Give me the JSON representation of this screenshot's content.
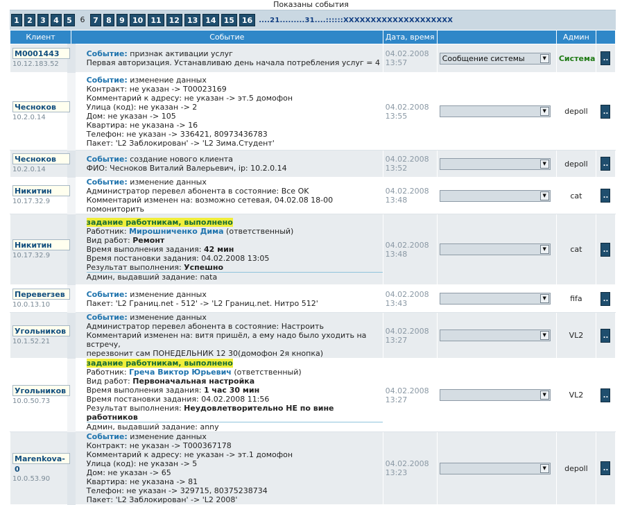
{
  "caption": "Показаны события",
  "pager": {
    "pages": [
      "1",
      "2",
      "3",
      "4",
      "5",
      "6",
      "7",
      "8",
      "9",
      "10",
      "11",
      "12",
      "13",
      "14",
      "15",
      "16"
    ],
    "current": "6",
    "tail": "....21.........31....::::::XXXXXXXXXXXXXXXXXXXX"
  },
  "columns": [
    "Клиент",
    "Событие",
    "Дата, время",
    "",
    "Админ",
    ""
  ],
  "rows": [
    {
      "client": "M0001443",
      "ip": "10.12.183.52",
      "event": [
        [
          "kw",
          "Событие:"
        ],
        [
          "t",
          " признак активации услуг"
        ],
        [
          "br"
        ],
        [
          "t",
          "Первая авторизация. Устанавливаю день начала потребления услуг = 4"
        ]
      ],
      "date": "04.02.2008",
      "time": "13:57",
      "select": "Сообщение системы",
      "admin": "Система",
      "admin_sys": true,
      "act": ".."
    },
    {
      "client": "Чесноков",
      "ip": "10.2.0.14",
      "event": [
        [
          "kw",
          "Событие:"
        ],
        [
          "t",
          " изменение данных"
        ],
        [
          "br"
        ],
        [
          "t",
          "Контракт: не указан -> T00023169"
        ],
        [
          "br"
        ],
        [
          "t",
          "Комментарий к адресу: не указан -> эт.5 домофон"
        ],
        [
          "br"
        ],
        [
          "t",
          "Улица (код): не указан -> 2"
        ],
        [
          "br"
        ],
        [
          "t",
          "Дом: не указан -> 105"
        ],
        [
          "br"
        ],
        [
          "t",
          "Квартира: не указана -> 16"
        ],
        [
          "br"
        ],
        [
          "t",
          "Телефон: не указан -> 336421, 80973436783"
        ],
        [
          "br"
        ],
        [
          "t",
          "Пакет: 'L2 Заблокирован' -> 'L2 Зима.Студент'"
        ]
      ],
      "date": "04.02.2008",
      "time": "13:55",
      "select": "",
      "admin": "depoll",
      "act": ".."
    },
    {
      "client": "Чесноков",
      "ip": "10.2.0.14",
      "event": [
        [
          "kw",
          "Событие:"
        ],
        [
          "t",
          " создание нового клиента"
        ],
        [
          "br"
        ],
        [
          "t",
          "ФИО: Чесноков Виталий Валерьевич, ip: 10.2.0.14"
        ]
      ],
      "date": "04.02.2008",
      "time": "13:52",
      "select": "",
      "admin": "depoll",
      "act": ".."
    },
    {
      "client": "Никитин",
      "ip": "10.17.32.9",
      "event": [
        [
          "kw",
          "Событие:"
        ],
        [
          "t",
          " изменение данных"
        ],
        [
          "br"
        ],
        [
          "t",
          "Администратор перевел абонента в состояние: Все OK"
        ],
        [
          "br"
        ],
        [
          "t",
          "Комментарий изменен на: возможно сетевая, 04.02.08 18-00 помониторить"
        ]
      ],
      "date": "04.02.2008",
      "time": "13:48",
      "select": "",
      "admin": "cat",
      "act": ".."
    },
    {
      "client": "Никитин",
      "ip": "10.17.32.9",
      "event": [
        [
          "task",
          "задание работникам, выполнено"
        ],
        [
          "br"
        ],
        [
          "t",
          "Работник: "
        ],
        [
          "worker",
          "Мирошниченко Дима"
        ],
        [
          "t",
          " (ответственный)"
        ],
        [
          "br"
        ],
        [
          "t",
          "Вид работ: "
        ],
        [
          "b",
          "Ремонт"
        ],
        [
          "br"
        ],
        [
          "t",
          "Время выполнения задания: "
        ],
        [
          "b",
          "42 мин"
        ],
        [
          "br"
        ],
        [
          "t",
          "Время постановки задания: 04.02.2008 13:05"
        ],
        [
          "br"
        ],
        [
          "ul",
          "Результат выполнения: ",
          "Успешно"
        ],
        [
          "t",
          "Админ, выдавший задание: nata"
        ]
      ],
      "date": "04.02.2008",
      "time": "13:48",
      "select": "",
      "admin": "cat",
      "act": ".."
    },
    {
      "client": "Перевerзев",
      "ip": "10.0.13.10",
      "event": [
        [
          "kw",
          "Событие:"
        ],
        [
          "t",
          " изменение данных"
        ],
        [
          "br"
        ],
        [
          "t",
          "Пакет: 'L2 Границ.net - 512' -> 'L2 Границ.net. Нитро 512'"
        ]
      ],
      "date": "04.02.2008",
      "time": "13:43",
      "select": "",
      "admin": "fifa",
      "act": ".."
    },
    {
      "client": "Угольников",
      "ip": "10.1.52.21",
      "event": [
        [
          "kw",
          "Событие:"
        ],
        [
          "t",
          " изменение данных"
        ],
        [
          "br"
        ],
        [
          "t",
          "Администратор перевел абонента в состояние: Настроить"
        ],
        [
          "br"
        ],
        [
          "t",
          "Комментарий изменен на: витя пришёл, а ему надо было уходить на встречу,"
        ],
        [
          "br"
        ],
        [
          "t",
          "перезвонит сам ПОНЕДЕЛЬНИК 12 30(домофон 2я кнопка)"
        ]
      ],
      "date": "04.02.2008",
      "time": "13:27",
      "select": "",
      "admin": "VL2",
      "act": ".."
    },
    {
      "client": "Угольников",
      "ip": "10.0.50.73",
      "event": [
        [
          "task",
          "задание работникам, выполнено"
        ],
        [
          "br"
        ],
        [
          "t",
          "Работник: "
        ],
        [
          "worker",
          "Греча Виктор Юрьевич"
        ],
        [
          "t",
          " (ответственный)"
        ],
        [
          "br"
        ],
        [
          "t",
          "Вид работ: "
        ],
        [
          "b",
          "Первоначальная настройка"
        ],
        [
          "br"
        ],
        [
          "t",
          "Время выполнения задания: "
        ],
        [
          "b",
          "1 час 30 мин"
        ],
        [
          "br"
        ],
        [
          "t",
          "Время постановки задания: 04.02.2008 11:56"
        ],
        [
          "br"
        ],
        [
          "ul",
          "Результат выполнения: ",
          "Неудовлетворительно НЕ по вине работников"
        ],
        [
          "t",
          "Админ, выдавший задание: anny"
        ]
      ],
      "date": "04.02.2008",
      "time": "13:27",
      "select": "",
      "admin": "VL2",
      "act": ".."
    },
    {
      "client": "Marenkova-0",
      "ip": "10.0.53.90",
      "event": [
        [
          "kw",
          "Событие:"
        ],
        [
          "t",
          " изменение данных"
        ],
        [
          "br"
        ],
        [
          "t",
          "Контракт: не указан -> T000367178"
        ],
        [
          "br"
        ],
        [
          "t",
          "Комментарий к адресу: не указан -> эт.1 домофон"
        ],
        [
          "br"
        ],
        [
          "t",
          "Улица (код): не указан -> 5"
        ],
        [
          "br"
        ],
        [
          "t",
          "Дом: не указан -> 65"
        ],
        [
          "br"
        ],
        [
          "t",
          "Квартира: не указана -> 81"
        ],
        [
          "br"
        ],
        [
          "t",
          "Телефон: не указан -> 329715, 80375238734"
        ],
        [
          "br"
        ],
        [
          "t",
          "Пакет: 'L2 Заблокирован' -> 'L2 2008'"
        ]
      ],
      "date": "04.02.2008",
      "time": "13:23",
      "select": "",
      "admin": "depoll",
      "act": ".."
    }
  ]
}
